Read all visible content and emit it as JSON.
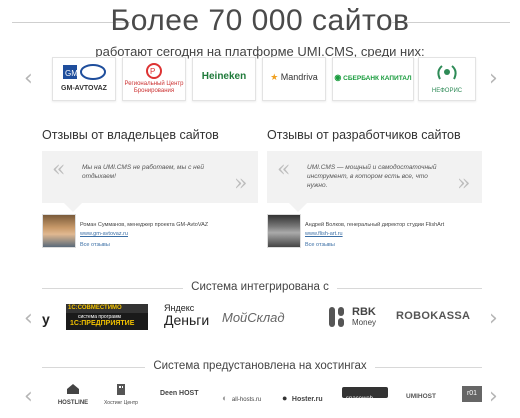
{
  "hero": {
    "title": "Более 70 000 сайтов",
    "subtitle": "работают сегодня на платформе UMI.CMS, среди них:"
  },
  "clients": [
    {
      "name": "GM-AVTOVAZ",
      "icon": "gm-avtovaz-logo"
    },
    {
      "name": "Региональный Центр Бронирования",
      "icon": "rcb-logo"
    },
    {
      "name": "Heineken",
      "icon": "heineken-logo"
    },
    {
      "name": "Mandriva",
      "icon": "mandriva-logo"
    },
    {
      "name": "СБЕРБАНК КАПИТАЛ",
      "icon": "sberbank-capital-logo"
    },
    {
      "name": "НЕФОРИС",
      "icon": "wreath-logo"
    }
  ],
  "reviews": {
    "owners": {
      "title": "Отзывы от владельцев сайтов",
      "quote": "Мы на UMI.CMS не работаем, мы с ней отдыхаем!",
      "author": "Роман Сумманов, менеджер проекта GM-AvtoVAZ",
      "site": "www.gm-avtovaz.ru",
      "all_link": "Все отзывы"
    },
    "developers": {
      "title": "Отзывы от разработчиков сайтов",
      "quote": "UMI.CMS — мощный и самодостаточный инструмент, в котором есть все, что нужно.",
      "author": "Андрей Волков, генеральный директор студии FlishArt",
      "site": "www.flish-art.ru",
      "all_link": "Все отзывы"
    }
  },
  "integrations": {
    "title": "Система интегрирована с",
    "items": [
      {
        "label": "у",
        "icon": "partial-logo"
      },
      {
        "label_top": "1С:СОВМЕСТИМО",
        "label_bottom": "1С:ПРЕДПРИЯТИЕ",
        "label_mid": "система программ",
        "icon": "1c-logo"
      },
      {
        "label_top": "Яндекс",
        "label_bottom": "Деньги",
        "icon": "yandex-money-logo"
      },
      {
        "label": "МойСклад",
        "icon": "moysklad-logo"
      },
      {
        "label_top": "RBK",
        "label_bottom": "Money",
        "icon": "rbk-money-logo"
      },
      {
        "label": "ROBOKASSA",
        "icon": "robokassa-logo"
      }
    ]
  },
  "hosting": {
    "title": "Система предустановлена на хостингах",
    "items": [
      {
        "label": "HOSTLINE",
        "icon": "house-icon"
      },
      {
        "label": "Хостинг Центр",
        "icon": "building-icon"
      },
      {
        "label": "Deen HOST",
        "icon": "deenhost-logo"
      },
      {
        "label": "all-hosts.ru",
        "icon": "allhosts-logo"
      },
      {
        "label": "Hoster.ru",
        "icon": "hoster-logo"
      },
      {
        "label": "spaceweb",
        "icon": "spaceweb-logo"
      },
      {
        "label": "UMIHOST",
        "icon": "umihost-logo"
      },
      {
        "label": "r01",
        "icon": "r01-logo"
      }
    ]
  },
  "colors": {
    "accent_green": "#2e7d32",
    "heineken_green": "#1f7a3a",
    "link_blue": "#3a6ea5",
    "sber_green": "#1a9c3e"
  }
}
